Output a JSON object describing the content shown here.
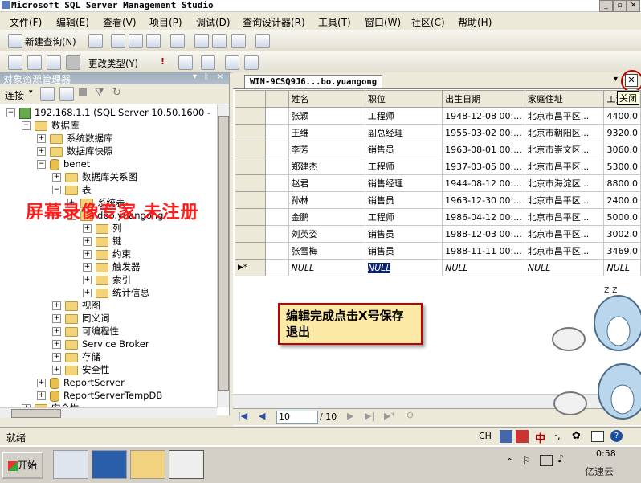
{
  "window": {
    "title": "Microsoft SQL Server Management Studio"
  },
  "menu": [
    "文件(F)",
    "编辑(E)",
    "查看(V)",
    "项目(P)",
    "调试(D)",
    "查询设计器(R)",
    "工具(T)",
    "窗口(W)",
    "社区(C)",
    "帮助(H)"
  ],
  "toolbar1": {
    "new_query": "新建查询(N)"
  },
  "toolbar2": {
    "change_type": "更改类型(Y)"
  },
  "object_explorer": {
    "title": "对象资源管理器",
    "connect": "连接",
    "tree": [
      {
        "label": "192.168.1.1 (SQL Server 10.50.1600 -",
        "level": 0,
        "expander": "−",
        "icon": "server"
      },
      {
        "label": "数据库",
        "level": 1,
        "expander": "−",
        "icon": "folder"
      },
      {
        "label": "系统数据库",
        "level": 2,
        "expander": "+",
        "icon": "folder"
      },
      {
        "label": "数据库快照",
        "level": 2,
        "expander": "+",
        "icon": "folder"
      },
      {
        "label": "benet",
        "level": 2,
        "expander": "−",
        "icon": "db"
      },
      {
        "label": "数据库关系图",
        "level": 3,
        "expander": "+",
        "icon": "folder"
      },
      {
        "label": "表",
        "level": 3,
        "expander": "−",
        "icon": "folder"
      },
      {
        "label": "系统表",
        "level": 4,
        "expander": "+",
        "icon": "folder"
      },
      {
        "label": "dbo.yuangong",
        "level": 4,
        "expander": "−",
        "icon": "table"
      },
      {
        "label": "列",
        "level": 5,
        "expander": "+",
        "icon": "folder"
      },
      {
        "label": "键",
        "level": 5,
        "expander": "+",
        "icon": "folder"
      },
      {
        "label": "约束",
        "level": 5,
        "expander": "+",
        "icon": "folder"
      },
      {
        "label": "触发器",
        "level": 5,
        "expander": "+",
        "icon": "folder"
      },
      {
        "label": "索引",
        "level": 5,
        "expander": "+",
        "icon": "folder"
      },
      {
        "label": "统计信息",
        "level": 5,
        "expander": "+",
        "icon": "folder"
      },
      {
        "label": "视图",
        "level": 3,
        "expander": "+",
        "icon": "folder"
      },
      {
        "label": "同义词",
        "level": 3,
        "expander": "+",
        "icon": "folder"
      },
      {
        "label": "可编程性",
        "level": 3,
        "expander": "+",
        "icon": "folder"
      },
      {
        "label": "Service Broker",
        "level": 3,
        "expander": "+",
        "icon": "folder"
      },
      {
        "label": "存储",
        "level": 3,
        "expander": "+",
        "icon": "folder"
      },
      {
        "label": "安全性",
        "level": 3,
        "expander": "+",
        "icon": "folder"
      },
      {
        "label": "ReportServer",
        "level": 2,
        "expander": "+",
        "icon": "db"
      },
      {
        "label": "ReportServerTempDB",
        "level": 2,
        "expander": "+",
        "icon": "db"
      },
      {
        "label": "安全性",
        "level": 1,
        "expander": "+",
        "icon": "folder"
      }
    ]
  },
  "document": {
    "tab_title": "WIN-9CSQ9J6...bo.yuangong",
    "close_tooltip": "关闭",
    "columns": [
      "姓名",
      "职位",
      "出生日期",
      "家庭住址",
      "工资"
    ],
    "rows": [
      [
        "张颖",
        "工程师",
        "1948-12-08 00:...",
        "北京市昌平区...",
        "4400.0"
      ],
      [
        "王维",
        "副总经理",
        "1955-03-02 00:...",
        "北京市朝阳区...",
        "9320.0"
      ],
      [
        "李芳",
        "销售员",
        "1963-08-01 00:...",
        "北京市崇文区...",
        "3060.0"
      ],
      [
        "郑建杰",
        "工程师",
        "1937-03-05 00:...",
        "北京市昌平区...",
        "5300.0"
      ],
      [
        "赵君",
        "销售经理",
        "1944-08-12 00:...",
        "北京市海淀区...",
        "8800.0"
      ],
      [
        "孙林",
        "销售员",
        "1963-12-30 00:...",
        "北京市昌平区...",
        "2400.0"
      ],
      [
        "金鹏",
        "工程师",
        "1986-04-12 00:...",
        "北京市昌平区...",
        "5000.0"
      ],
      [
        "刘英姿",
        "销售员",
        "1988-12-03 00:...",
        "北京市昌平区...",
        "3002.0"
      ],
      [
        "张雪梅",
        "销售员",
        "1988-11-11 00:...",
        "北京市昌平区...",
        "3469.0"
      ]
    ],
    "new_row_marker": "▶*",
    "null_text": "NULL",
    "nav": {
      "current": "10",
      "total": "/ 10"
    }
  },
  "annotation": "编辑完成点击X号保存退出",
  "watermark": "屏幕录像专家  未注册",
  "status": {
    "text": "就绪",
    "mode": "CH"
  },
  "taskbar": {
    "start": "开始",
    "clock": "0:58",
    "brand": "亿速云"
  },
  "colors": {
    "watermark": "#ff1a1a",
    "annotation_border": "#c00000",
    "selection": "#0a246a"
  }
}
